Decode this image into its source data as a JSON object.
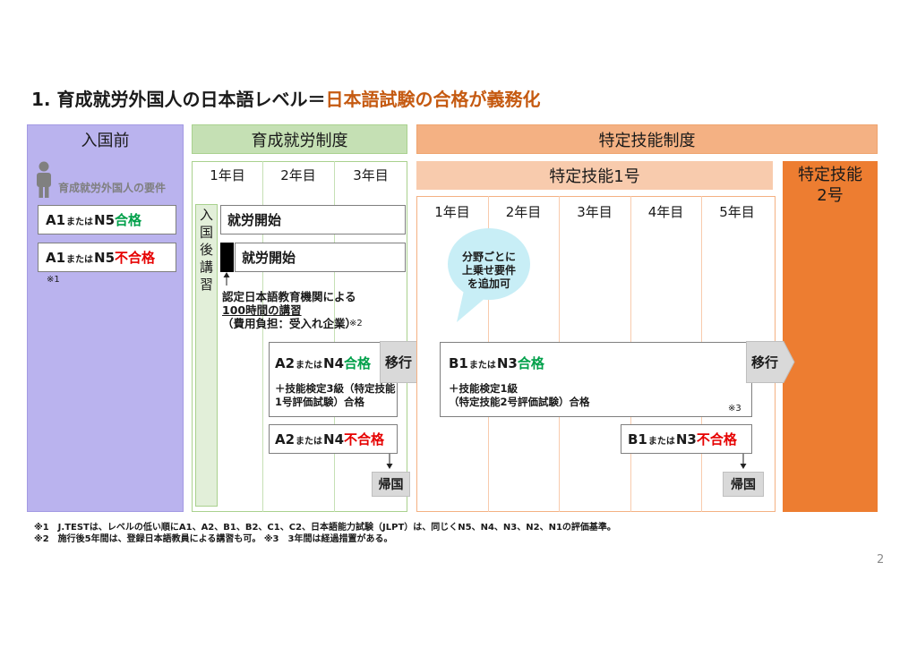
{
  "title": {
    "prefix": "1. 育成就労外国人の日本語レベル＝",
    "highlight": "日本語試験の合格が義務化"
  },
  "colors": {
    "title_accent": "#c55a11",
    "pass": "#00a04a",
    "fail": "#e60000",
    "pre_entry_bg": "#bab3ee",
    "ikusei_header_bg": "#c5e0b4",
    "tokutei_header_bg": "#f4b183",
    "tokutei_type1_bg": "#f8cbad",
    "tokutei_type2_bg": "#ed7d31",
    "bubble_bg": "#c8eef6"
  },
  "pre_entry": {
    "header": "入国前",
    "icon": "person-icon",
    "requirements_label": "育成就労外国人の要件",
    "pass_box": {
      "level_a": "A1",
      "connector": "または",
      "level_b": "N5",
      "result": "合格"
    },
    "fail_box": {
      "level_a": "A1",
      "connector": "または",
      "level_b": "N5",
      "result": "不合格"
    },
    "note_ref": "※1"
  },
  "ikusei": {
    "header": "育成就労制度",
    "years": [
      "1年目",
      "2年目",
      "3年目"
    ],
    "training_label": "入国後講習",
    "work_start_rows": [
      "就労開始",
      "就労開始"
    ],
    "training_note": {
      "line1": "認定日本語教育機関による",
      "line2": "100時間の講習",
      "line3": "（費用負担：受入れ企業）",
      "ref": "※2"
    },
    "pass_box": {
      "level_a": "A2",
      "connector": "または",
      "level_b": "N4",
      "result": "合格",
      "detail": [
        "＋技能検定3級（特定技能",
        "1号評価試験）合格"
      ]
    },
    "transition": "移行",
    "fail_box": {
      "level_a": "A2",
      "connector": "または",
      "level_b": "N4",
      "result": "不合格"
    },
    "return": "帰国"
  },
  "tokutei": {
    "header": "特定技能制度",
    "type1": {
      "header": "特定技能1号",
      "years": [
        "1年目",
        "2年目",
        "3年目",
        "4年目",
        "5年目"
      ],
      "bubble": [
        "分野ごとに",
        "上乗せ要件",
        "を追加可"
      ],
      "pass_box": {
        "level_a": "B1",
        "connector": "または",
        "level_b": "N3",
        "result": "合格",
        "detail": [
          "＋技能検定1級",
          "（特定技能2号評価試験）合格"
        ],
        "ref": "※3"
      },
      "transition": "移行",
      "fail_box": {
        "level_a": "B1",
        "connector": "または",
        "level_b": "N3",
        "result": "不合格"
      },
      "return": "帰国"
    },
    "type2": {
      "line1": "特定技能",
      "line2": "2号"
    }
  },
  "footnotes": [
    "※1　J.TESTは、レベルの低い順にA1、A2、B1、B2、C1、C2、日本語能力試験（JLPT）は、同じくN5、N4、N3、N2、N1の評価基準。",
    "※2　施行後5年間は、登録日本語教員による講習も可。 ※3　3年間は経過措置がある。"
  ],
  "page_number": "2"
}
